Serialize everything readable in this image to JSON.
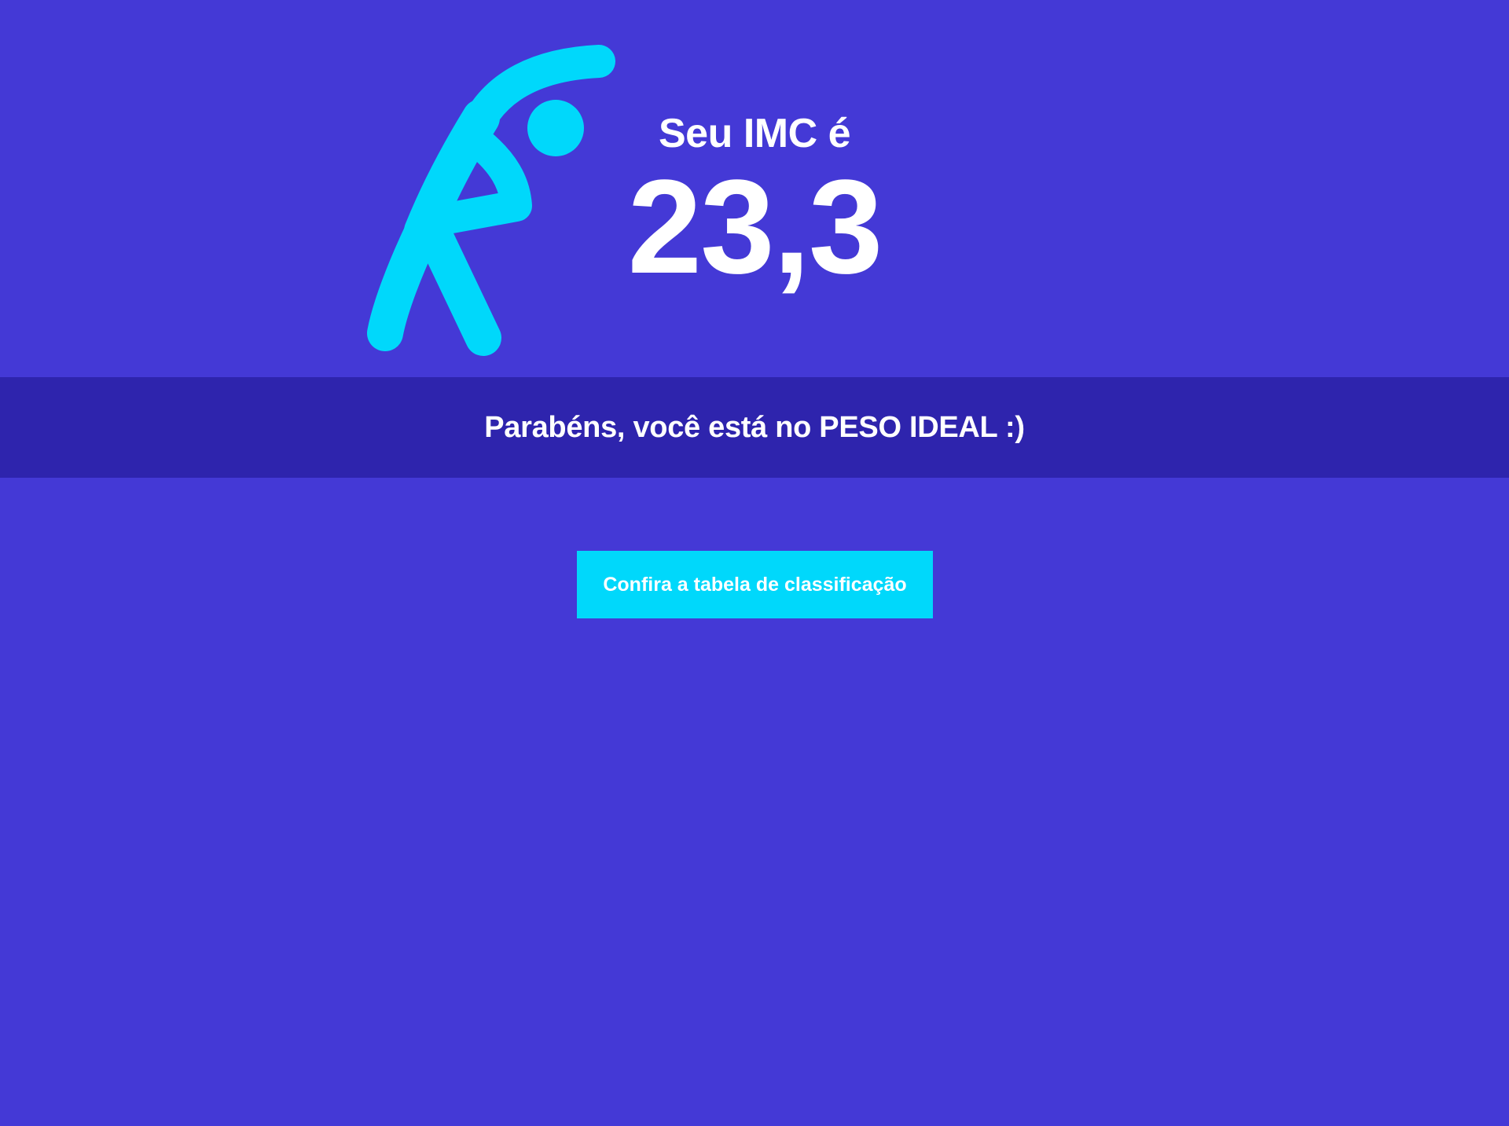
{
  "hero": {
    "icon": "stretching-person-icon",
    "icon_color": "#00d8fb",
    "result_label": "Seu IMC é",
    "result_value": "23,3"
  },
  "banner": {
    "message": "Parabéns, você está no PESO IDEAL :)"
  },
  "actions": {
    "table_button_label": "Confira a tabela de classificação"
  },
  "colors": {
    "background": "#4439d6",
    "banner_background": "#2e24ad",
    "accent": "#00d8fb",
    "text": "#ffffff"
  }
}
